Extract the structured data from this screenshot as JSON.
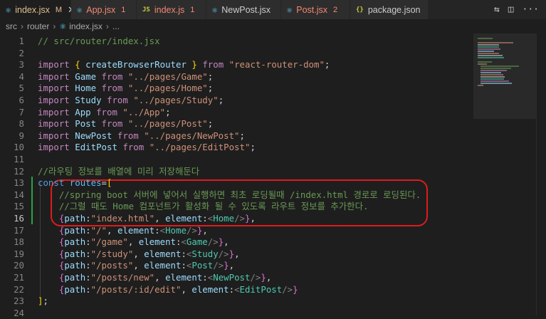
{
  "tabs": [
    {
      "icon": "react-icon",
      "label": "index.jsx",
      "badge": "M",
      "state": "modified",
      "active": true
    },
    {
      "icon": "react-icon",
      "label": "App.jsx",
      "badge": "1",
      "state": "error",
      "active": false
    },
    {
      "icon": "js-icon",
      "label": "index.js",
      "badge": "1",
      "state": "error",
      "active": false
    },
    {
      "icon": "react-icon",
      "label": "NewPost.jsx",
      "badge": "",
      "state": "normal",
      "active": false
    },
    {
      "icon": "react-icon",
      "label": "Post.jsx",
      "badge": "2",
      "state": "error",
      "active": false
    },
    {
      "icon": "json-icon",
      "label": "package.json",
      "badge": "",
      "state": "normal",
      "active": false
    }
  ],
  "breadcrumb": {
    "items": [
      "src",
      "router",
      "index.jsx",
      "..."
    ]
  },
  "editor": {
    "current_line": 16,
    "lines": [
      {
        "n": "1",
        "text": "// src/router/index.jsx"
      },
      {
        "n": "2",
        "text": ""
      },
      {
        "n": "3",
        "text": "import { createBrowserRouter } from \"react-router-dom\";"
      },
      {
        "n": "4",
        "text": "import Game from \"../pages/Game\";"
      },
      {
        "n": "5",
        "text": "import Home from \"../pages/Home\";"
      },
      {
        "n": "6",
        "text": "import Study from \"../pages/Study\";"
      },
      {
        "n": "7",
        "text": "import App from \"../App\";"
      },
      {
        "n": "8",
        "text": "import Post from \"../pages/Post\";"
      },
      {
        "n": "9",
        "text": "import NewPost from \"../pages/NewPost\";"
      },
      {
        "n": "10",
        "text": "import EditPost from \"../pages/EditPost\";"
      },
      {
        "n": "11",
        "text": ""
      },
      {
        "n": "12",
        "text": "//라우팅 정보를 배열에 미리 저장해둔다"
      },
      {
        "n": "13",
        "text": "const routes=["
      },
      {
        "n": "14",
        "text": "    //spring boot 서버에 넣어서 실행하면 최초 로딩될때 /index.html 경로로 로딩된다."
      },
      {
        "n": "15",
        "text": "    //그럴 때도 Home 컴포넌트가 활성화 될 수 있도록 라우트 정보를 추가한다."
      },
      {
        "n": "16",
        "text": "    {path:\"index.html\", element:<Home/>},"
      },
      {
        "n": "17",
        "text": "    {path:\"/\", element:<Home/>},"
      },
      {
        "n": "18",
        "text": "    {path:\"/game\", element:<Game/>},"
      },
      {
        "n": "19",
        "text": "    {path:\"/study\", element:<Study/>},"
      },
      {
        "n": "20",
        "text": "    {path:\"/posts\", element:<Post/>},"
      },
      {
        "n": "21",
        "text": "    {path:\"/posts/new\", element:<NewPost/>},"
      },
      {
        "n": "22",
        "text": "    {path:\"/posts/:id/edit\", element:<EditPost/>}"
      },
      {
        "n": "23",
        "text": "];"
      },
      {
        "n": "24",
        "text": ""
      }
    ]
  },
  "colors": {
    "modified": "#e2c08d",
    "error": "#f48771",
    "annotation": "#e01b1b",
    "added_gutter": "#2ea043"
  }
}
